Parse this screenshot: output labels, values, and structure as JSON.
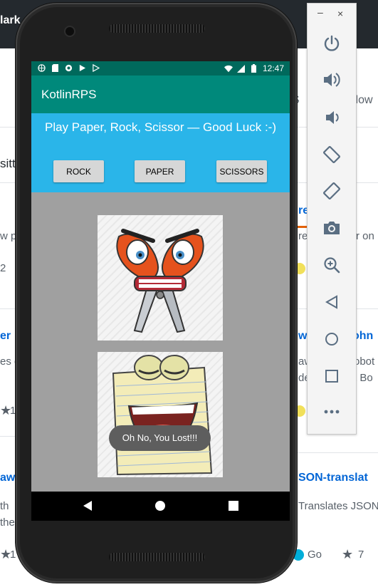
{
  "background": {
    "topbar_text": "lark",
    "tab_fragment_1": "S",
    "tab_fragment_2": "llow",
    "row1_left_text": "sitt",
    "row2_left_text": "w p",
    "row2_left_num": "2",
    "row2_right_link": "re",
    "row2_right_text": "re",
    "row2_right_text2": "r on",
    "row2_right_text3": "t",
    "row3_left_link": "er",
    "row3_left_text": "es o",
    "row3_left_num": "1",
    "row3_right_link": "w",
    "row3_right_link2": "ohn",
    "row3_right_text": "aw",
    "row3_right_text2": "obot",
    "row3_right_text3": "de",
    "row3_right_text4": "t Bo",
    "row3_right_text5": "t",
    "row4_left_link": "aw",
    "row4_left_text": "th",
    "row4_left_text2": "the",
    "row4_left_num": "1",
    "row4_right_link": "SON-translat",
    "row4_right_text": "Translates JSON",
    "row4_right_lang": "Go",
    "row4_right_stars": "7",
    "lang_yellow": "#f1e05a",
    "lang_go": "#00add8"
  },
  "device": {
    "status_time": "12:47",
    "app_title": "KotlinRPS",
    "headline": "Play Paper, Rock, Scissor — Good Luck :-)",
    "buttons": {
      "rock": "ROCK",
      "paper": "PAPER",
      "scissors": "SCISSORS"
    },
    "cards": {
      "top": "scissors-character",
      "bottom": "paper-character"
    },
    "toast": "Oh No, You Lost!!!",
    "colors": {
      "statusbar": "#00695c",
      "appbar": "#00897b",
      "controls": "#2ab5e9",
      "gamearea": "#a0a0a0"
    }
  },
  "emulator": {
    "minimize": "–",
    "close": "×",
    "icons": [
      "power-icon",
      "volume-up-icon",
      "volume-down-icon",
      "rotate-left-icon",
      "rotate-right-icon",
      "camera-icon",
      "zoom-icon",
      "back-icon",
      "home-icon",
      "overview-icon",
      "more-icon"
    ]
  }
}
